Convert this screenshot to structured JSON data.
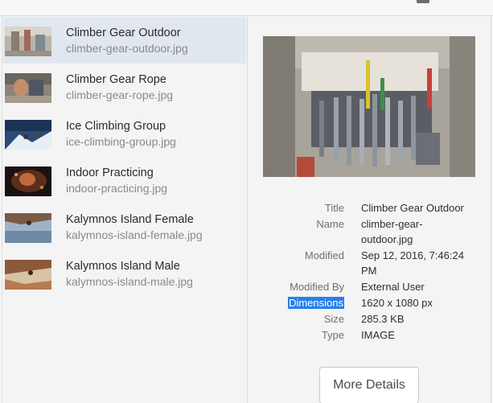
{
  "list": {
    "items": [
      {
        "title": "Climber Gear Outdoor",
        "file": "climber-gear-outdoor.jpg",
        "selected": true
      },
      {
        "title": "Climber Gear Rope",
        "file": "climber-gear-rope.jpg",
        "selected": false
      },
      {
        "title": "Ice Climbing Group",
        "file": "ice-climbing-group.jpg",
        "selected": false
      },
      {
        "title": "Indoor Practicing",
        "file": "indoor-practicing.jpg",
        "selected": false
      },
      {
        "title": "Kalymnos Island Female",
        "file": "kalymnos-island-female.jpg",
        "selected": false
      },
      {
        "title": "Kalymnos Island Male",
        "file": "kalymnos-island-male.jpg",
        "selected": false
      }
    ]
  },
  "details": {
    "fields": [
      {
        "label": "Title",
        "value": "Climber Gear Outdoor"
      },
      {
        "label": "Name",
        "value": "climber-gear-outdoor.jpg"
      },
      {
        "label": "Modified",
        "value": "Sep 12, 2016, 7:46:24 PM"
      },
      {
        "label": "Modified By",
        "value": "External User"
      },
      {
        "label": "Dimensions",
        "value": "1620 x 1080 px"
      },
      {
        "label": "Size",
        "value": "285.3 KB"
      },
      {
        "label": "Type",
        "value": "IMAGE"
      }
    ],
    "more_details_label": "More Details"
  },
  "colors": {
    "selected_row": "#e1e7ef",
    "selection_highlight": "#2680eb"
  }
}
